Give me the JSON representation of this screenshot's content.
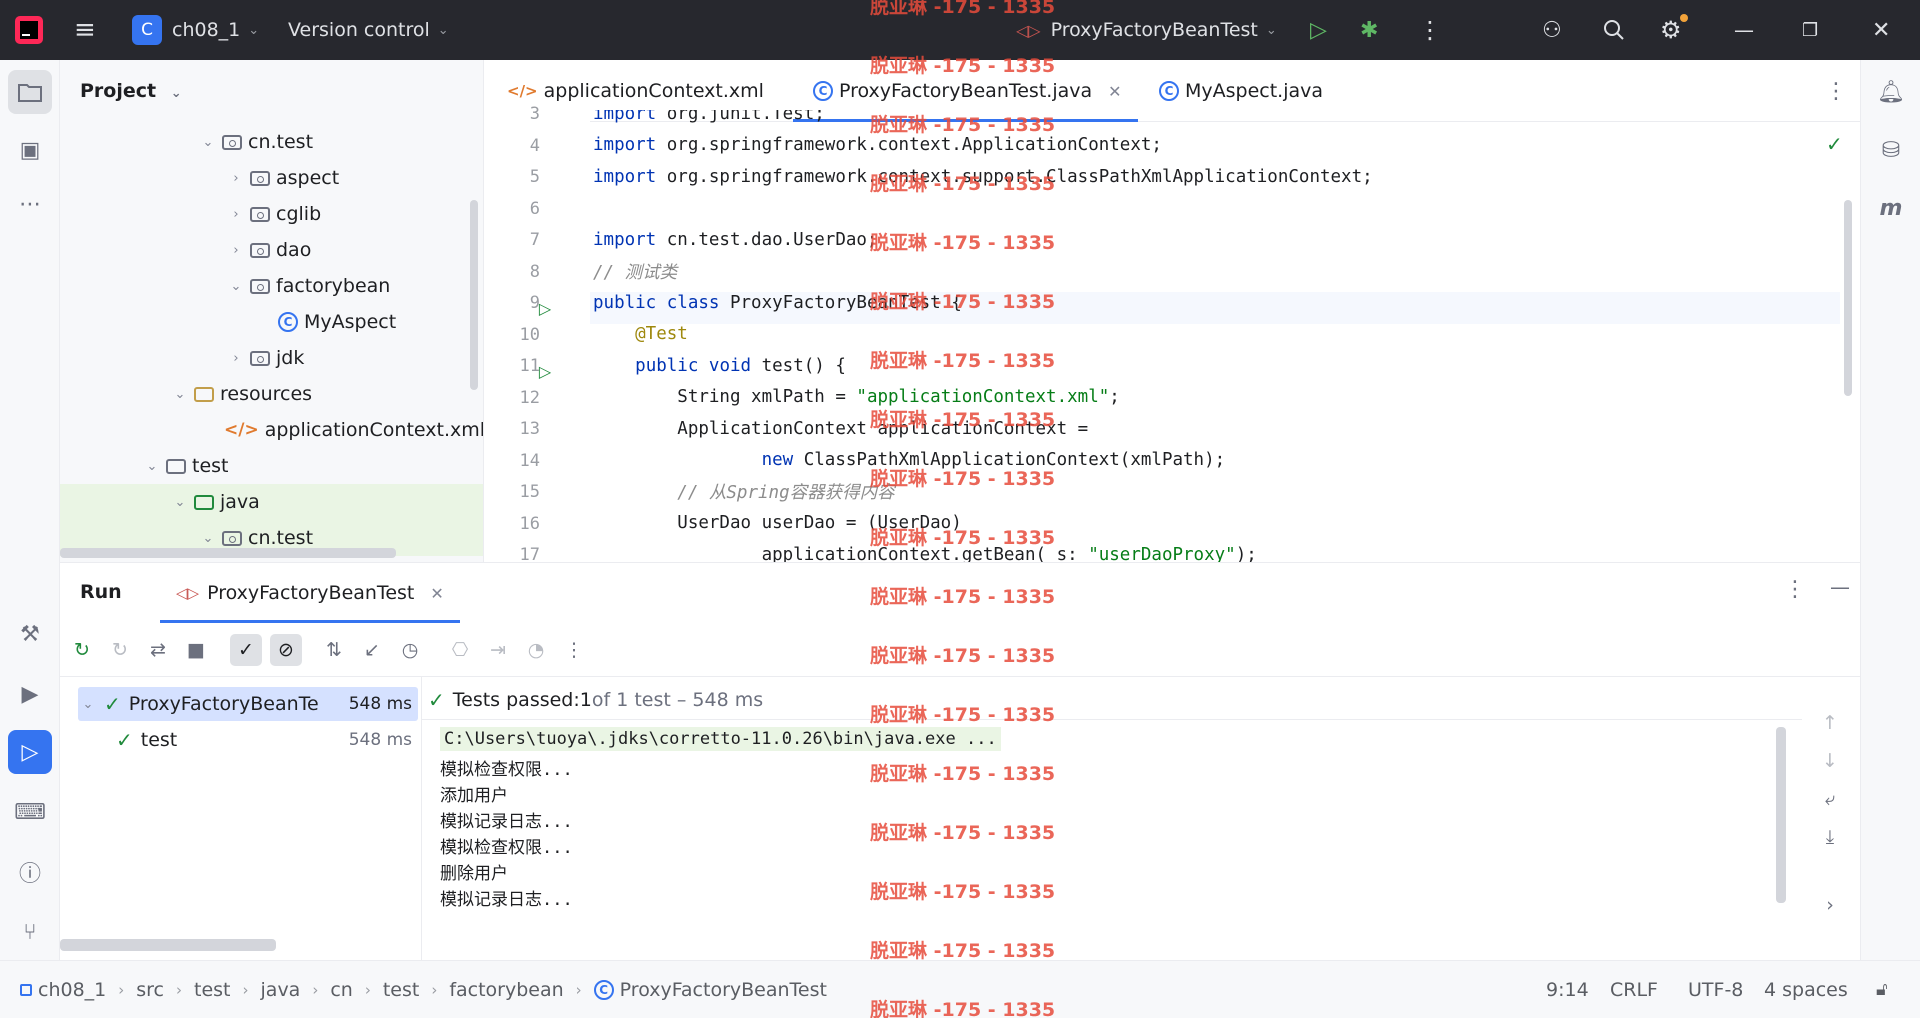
{
  "titlebar": {
    "project_initial": "C",
    "project_name": "ch08_1",
    "vcs_label": "Version control",
    "run_config": "ProxyFactoryBeanTest"
  },
  "project_panel": {
    "title": "Project",
    "tree": [
      {
        "label": "cn.test",
        "type": "package",
        "expanded": true
      },
      {
        "label": "aspect",
        "type": "package",
        "expanded": false
      },
      {
        "label": "cglib",
        "type": "package",
        "expanded": false
      },
      {
        "label": "dao",
        "type": "package",
        "expanded": false
      },
      {
        "label": "factorybean",
        "type": "package",
        "expanded": true
      },
      {
        "label": "MyAspect",
        "type": "class"
      },
      {
        "label": "jdk",
        "type": "package",
        "expanded": false
      },
      {
        "label": "resources",
        "type": "folder",
        "expanded": true
      },
      {
        "label": "applicationContext.xml",
        "type": "xml"
      },
      {
        "label": "test",
        "type": "folder",
        "expanded": true
      },
      {
        "label": "java",
        "type": "folder",
        "expanded": true
      },
      {
        "label": "cn.test",
        "type": "package",
        "expanded": true
      }
    ]
  },
  "editor": {
    "tabs": [
      {
        "label": "applicationContext.xml",
        "icon": "xml-icon"
      },
      {
        "label": "ProxyFactoryBeanTest.java",
        "icon": "class-icon",
        "active": true
      },
      {
        "label": "MyAspect.java",
        "icon": "class-icon"
      }
    ],
    "lines": [
      {
        "n": "3",
        "text": "import org.junit.Test;"
      },
      {
        "n": "4",
        "text": "import org.springframework.context.ApplicationContext;"
      },
      {
        "n": "5",
        "text": "import org.springframework.context.support.ClassPathXmlApplicationContext;"
      },
      {
        "n": "6",
        "text": ""
      },
      {
        "n": "7",
        "text": "import cn.test.dao.UserDao;"
      },
      {
        "n": "8",
        "text": "// 测试类"
      },
      {
        "n": "9",
        "text": "public class ProxyFactoryBeanTest {"
      },
      {
        "n": "10",
        "text": "    @Test"
      },
      {
        "n": "11",
        "text": "    public void test() {"
      },
      {
        "n": "12",
        "text": "        String xmlPath = \"applicationContext.xml\";"
      },
      {
        "n": "13",
        "text": "        ApplicationContext applicationContext ="
      },
      {
        "n": "14",
        "text": "                new ClassPathXmlApplicationContext(xmlPath);"
      },
      {
        "n": "15",
        "text": "        // 从Spring容器获得内容"
      },
      {
        "n": "16",
        "text": "        UserDao userDao = (UserDao)"
      },
      {
        "n": "17",
        "text": "                applicationContext.getBean( s: \"userDaoProxy\");"
      }
    ]
  },
  "run_panel": {
    "title": "Run",
    "tab_label": "ProxyFactoryBeanTest",
    "tests": [
      {
        "label": "ProxyFactoryBeanTe",
        "time": "548 ms"
      },
      {
        "label": "test",
        "time": "548 ms"
      }
    ],
    "summary_prefix": "Tests passed: ",
    "summary_count": "1",
    "summary_rest": " of 1 test – 548 ms",
    "console": [
      "C:\\Users\\tuoya\\.jdks\\corretto-11.0.26\\bin\\java.exe ...",
      "模拟检查权限...",
      "添加用户",
      "模拟记录日志...",
      "模拟检查权限...",
      "删除用户",
      "模拟记录日志..."
    ]
  },
  "statusbar": {
    "breadcrumbs": [
      "ch08_1",
      "src",
      "test",
      "java",
      "cn",
      "test",
      "factorybean",
      "ProxyFactoryBeanTest"
    ],
    "position": "9:14",
    "line_sep": "CRLF",
    "encoding": "UTF-8",
    "indent": "4 spaces"
  },
  "watermark": "脱亚琳 -175 - 1335",
  "colors": {
    "accent": "#3574f0",
    "success": "#208a3c",
    "watermark": "#e74c3c"
  }
}
